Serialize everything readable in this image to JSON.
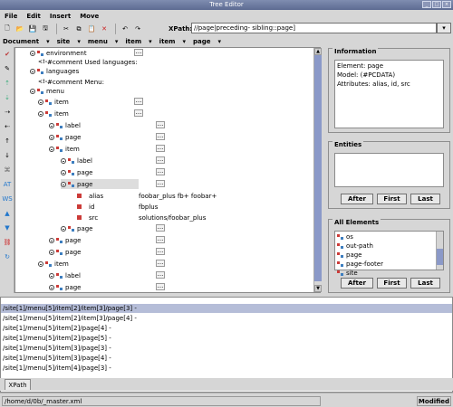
{
  "window": {
    "title": "Tree Editor"
  },
  "menu": {
    "file": "File",
    "edit": "Edit",
    "insert": "Insert",
    "move": "Move"
  },
  "toolbar": {
    "xpath_label": "XPath:",
    "xpath_value": "//page|preceding- sibling::page]"
  },
  "breadcrumb": [
    "Document",
    "site",
    "menu",
    "item",
    "item",
    "page"
  ],
  "tree": {
    "row1": "environment",
    "row2": "#comment Used languages:",
    "row3": "languages",
    "row4": "#comment Menu:",
    "row5": "menu",
    "row6": "item",
    "row7": "item",
    "row8": "label",
    "row9": "page",
    "row10": "item",
    "row11": "label",
    "row12": "page",
    "row13": "page",
    "row14": "alias",
    "row15": "id",
    "row16": "src",
    "row17": "page",
    "row18": "page",
    "row19": "page",
    "row20": "item",
    "row21": "label",
    "row22": "page",
    "row23": "page",
    "val14": "foobar_plus fb+ foobar+",
    "val15": "fbplus",
    "val16": "solutions/foobar_plus"
  },
  "information": {
    "title": "Information",
    "element": "Element: page",
    "model": "Model: (#PCDATA)",
    "attributes": "Attributes: alias, id, src"
  },
  "entities": {
    "title": "Entities",
    "after": "After",
    "first": "First",
    "last": "Last"
  },
  "all_elements": {
    "title": "All Elements",
    "items": [
      "os",
      "out-path",
      "page",
      "page-footer",
      "site"
    ],
    "after": "After",
    "first": "First",
    "last": "Last"
  },
  "results": [
    "/site[1]/menu[5]/item[2]/item[3]/page[3] -",
    "/site[1]/menu[5]/item[2]/item[3]/page[4] -",
    "/site[1]/menu[5]/item[2]/page[4] -",
    "/site[1]/menu[5]/item[2]/page[5] -",
    "/site[1]/menu[5]/item[3]/page[3] -",
    "/site[1]/menu[5]/item[3]/page[4] -",
    "/site[1]/menu[5]/item[4]/page[3] -"
  ],
  "tab": "XPath",
  "status": {
    "path": "/home/d/0b/_master.xml",
    "state": "Modified"
  }
}
